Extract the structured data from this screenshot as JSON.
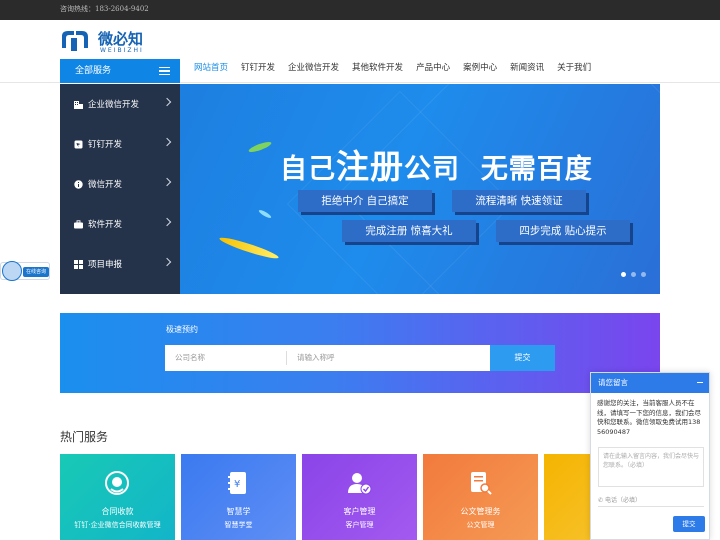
{
  "topbar": {
    "hotline": "咨询热线：183-2604-9402"
  },
  "header": {
    "logo_text": "微必知",
    "logo_sub": "WEIBIZHI"
  },
  "nav": {
    "all_services": "全部服务",
    "links": [
      "网站首页",
      "钉钉开发",
      "企业微信开发",
      "其他软件开发",
      "产品中心",
      "案例中心",
      "新闻资讯",
      "关于我们"
    ]
  },
  "sidebar": {
    "items": [
      {
        "label": "企业微信开发",
        "icon": "building-icon"
      },
      {
        "label": "钉钉开发",
        "icon": "dingtalk-icon"
      },
      {
        "label": "微信开发",
        "icon": "info-icon"
      },
      {
        "label": "软件开发",
        "icon": "briefcase-icon"
      },
      {
        "label": "项目申报",
        "icon": "grid-icon"
      }
    ]
  },
  "banner": {
    "title_a": "自己",
    "title_b": "注册",
    "title_c": "公司",
    "title_d": "无需百度",
    "pills": [
      "拒绝中介  自己搞定",
      "流程清晰  快速领证",
      "完成注册  惊喜大礼",
      "四步完成  贴心提示"
    ]
  },
  "booking": {
    "label": "极速预约",
    "company_placeholder": "公司名称",
    "name_placeholder": "请输入称呼",
    "submit": "提交"
  },
  "hot_services": {
    "title": "热门服务",
    "cards": [
      {
        "title": "合同收款",
        "subtitle": "钉钉·企业微信合同收款管理",
        "color_from": "#19c9b5",
        "color_to": "#12b5c9",
        "icon": "headset-icon"
      },
      {
        "title": "智慧学",
        "subtitle": "智慧学堂",
        "color_from": "#3a7af0",
        "color_to": "#5f8ef5",
        "icon": "yen-book-icon"
      },
      {
        "title": "客户管理",
        "subtitle": "客户管理",
        "color_from": "#8a44e8",
        "color_to": "#a35af0",
        "icon": "user-check-icon"
      },
      {
        "title": "公文管理务",
        "subtitle": "公文管理",
        "color_from": "#f27a3c",
        "color_to": "#f59a55",
        "icon": "document-search-icon"
      },
      {
        "title": "",
        "subtitle": "",
        "color_from": "#f5b400",
        "color_to": "#f7c63a",
        "icon": "partial-icon"
      }
    ]
  },
  "float_tab": {
    "label": "在线咨询"
  },
  "chat": {
    "header": "请您留言",
    "message": "感谢您的关注，当前客服人员不在线，请填写一下您的信息，我们会尽快和您联系。微信领取免费试用13856090487",
    "textarea_placeholder": "请在此输入留言内容，我们会尽快与您联系。（必填）",
    "phone_placeholder": "电话（必填）",
    "send": "提交"
  }
}
